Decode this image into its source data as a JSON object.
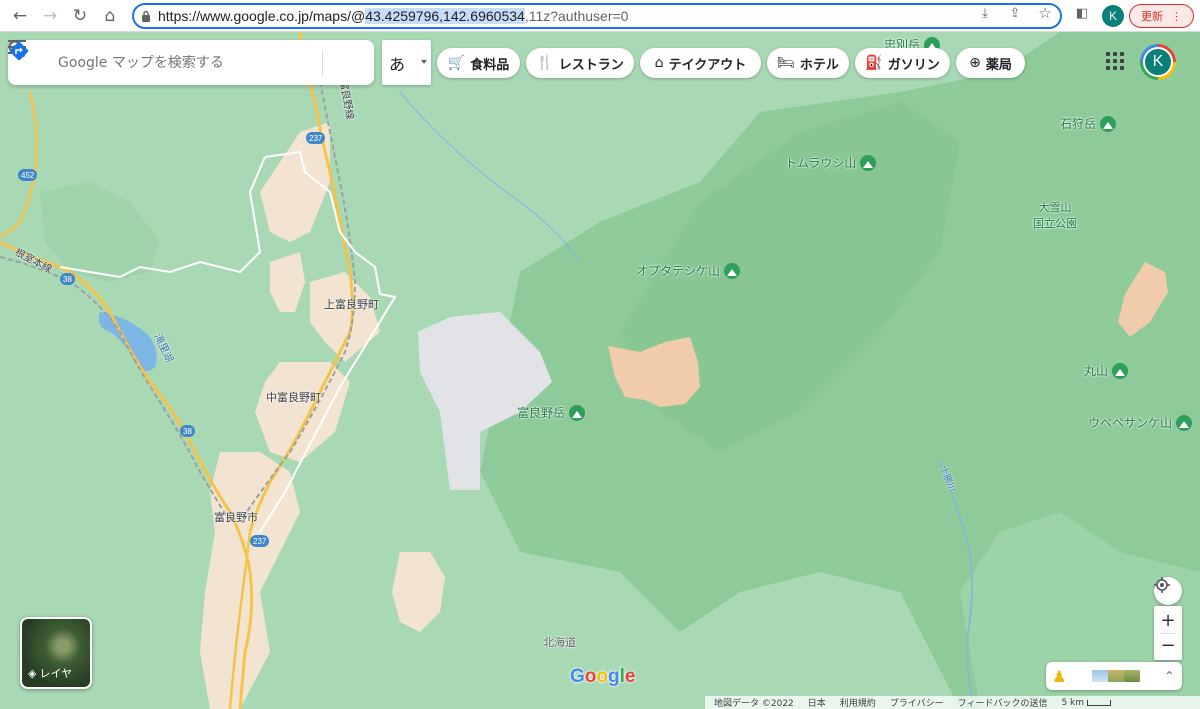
{
  "browser": {
    "url_prefix": "https://www.google.co.jp/maps/@",
    "url_selected": "43.4259796,142.6960534",
    "url_suffix": ",11z?authuser=0",
    "profile_initial": "K",
    "update_label": "更新"
  },
  "search": {
    "placeholder": "Google マップを検索する"
  },
  "ime": {
    "label": "あ"
  },
  "chips": [
    {
      "icon": "🛒",
      "label": "食料品"
    },
    {
      "icon": "🍴",
      "label": "レストラン"
    },
    {
      "icon": "⌂",
      "label": "テイクアウト"
    },
    {
      "icon": "🛏",
      "label": "ホテル"
    },
    {
      "icon": "⛽",
      "label": "ガソリン"
    },
    {
      "icon": "⊕",
      "label": "薬局"
    }
  ],
  "account": {
    "initial": "K"
  },
  "peaks": [
    {
      "name": "忠別岳"
    },
    {
      "name": "石狩岳"
    },
    {
      "name": "トムラウシ山"
    },
    {
      "name": "オプタテシケ山"
    },
    {
      "name": "富良野岳"
    },
    {
      "name": "丸山"
    },
    {
      "name": "ウペペサンケ山"
    }
  ],
  "places": {
    "park": "大雪山\n国立公園",
    "kamifurano": "上富良野町",
    "nakafurano": "中富良野町",
    "furano": "富良野市",
    "hokkaido": "北海道",
    "nemuro_line": "根室本線",
    "furano_line": "富良野線",
    "lake": "滝里湖",
    "river": "十勝川"
  },
  "routes": {
    "r237a": "237",
    "r452": "452",
    "r38a": "38",
    "r38b": "38",
    "r237b": "237"
  },
  "layers": {
    "label": "レイヤ"
  },
  "logo": "Google",
  "footer": {
    "map_data": "地図データ ©2022",
    "country": "日本",
    "terms": "利用規約",
    "privacy": "プライバシー",
    "feedback": "フィードバックの送信",
    "scale": "5 km"
  },
  "colors": {
    "accent": "#1a73e8",
    "forest": "#a9d9b4",
    "park": "#8fcb9a",
    "urban": "#f2e4d0",
    "road": "#f6c34a"
  }
}
